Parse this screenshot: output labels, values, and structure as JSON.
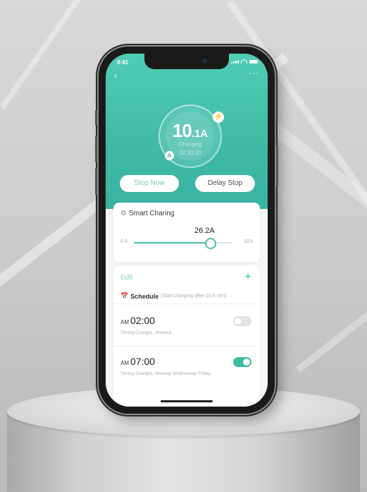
{
  "status_bar": {
    "time": "9:41"
  },
  "hero": {
    "current_value": "10",
    "current_decimal": ".1",
    "current_unit": "A",
    "status": "Charging",
    "timer": "02:30:20",
    "plug_icon": "plug-icon",
    "accent_color": "#3fbaa6"
  },
  "buttons": {
    "stop_now": "Stop Now",
    "delay_stop": "Delay Stop"
  },
  "smart": {
    "title": "Smart Charing",
    "value_label": "26.2A",
    "min_label": "6 A",
    "max_label": "32A",
    "value_fraction": 0.78
  },
  "schedule": {
    "edit": "Edit",
    "add": "+",
    "title": "Schedule",
    "note": "(Start charging after 10 h ctrn)",
    "items": [
      {
        "ampm": "AM",
        "time": "02:00",
        "desc": "Timing Charges, Mondse",
        "enabled": false
      },
      {
        "ampm": "AM",
        "time": "07:00",
        "desc": "Timing Charges, Monday Wednesday Friday",
        "enabled": true
      }
    ]
  }
}
